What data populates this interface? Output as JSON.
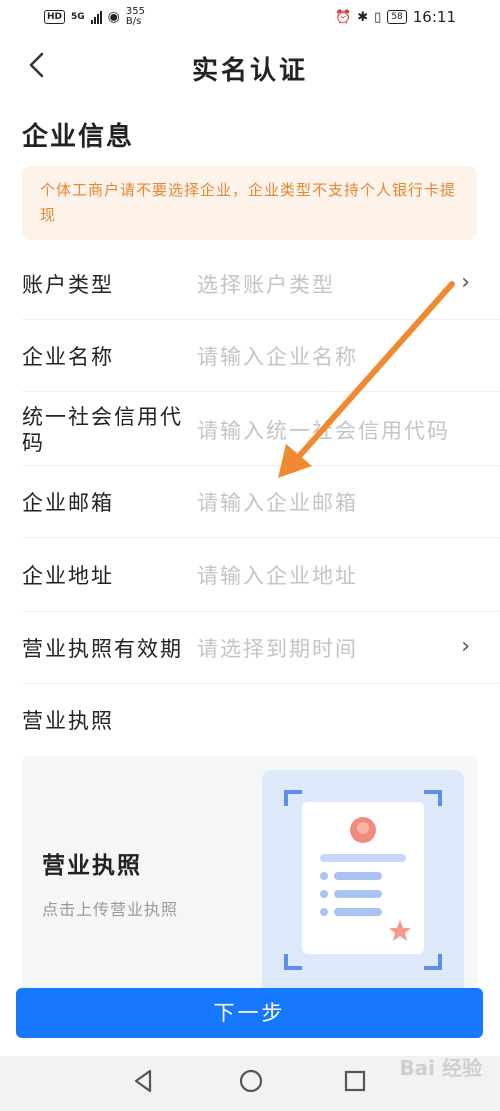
{
  "status_bar": {
    "network_hd": "HD",
    "network_5g": "5G",
    "speed_value": "355",
    "speed_unit": "B/s",
    "battery": "58",
    "time": "16:11"
  },
  "nav": {
    "title": "实名认证"
  },
  "section": {
    "title": "企业信息"
  },
  "notice": {
    "text": "个体工商户请不要选择企业，企业类型不支持个人银行卡提现"
  },
  "form": {
    "rows": [
      {
        "label": "账户类型",
        "placeholder": "选择账户类型"
      },
      {
        "label": "企业名称",
        "placeholder": "请输入企业名称"
      },
      {
        "label_line1": "统一社会信用代",
        "label_line2": "码",
        "placeholder": "请输入统一社会信用代码"
      },
      {
        "label": "企业邮箱",
        "placeholder": "请输入企业邮箱"
      },
      {
        "label": "企业地址",
        "placeholder": "请输入企业地址"
      },
      {
        "label": "营业执照有效期",
        "placeholder": "请选择到期时间"
      },
      {
        "label": "营业执照"
      }
    ]
  },
  "upload": {
    "title": "营业执照",
    "subtitle": "点击上传营业执照"
  },
  "footer": {
    "next_label": "下一步"
  },
  "watermark": {
    "text": "Bai 经验"
  },
  "colors": {
    "primary": "#1677ff",
    "notice_text": "#e8852f",
    "notice_bg": "#fdf3ea",
    "annotation_arrow": "#f08a32"
  }
}
